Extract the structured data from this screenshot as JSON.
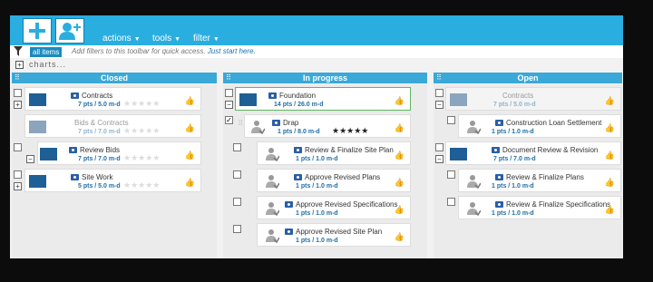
{
  "toolbar": {
    "menus": [
      {
        "label": "actions"
      },
      {
        "label": "tools"
      },
      {
        "label": "filter"
      }
    ]
  },
  "filterbar": {
    "chip": "all items",
    "hint": "Add filters to this toolbar for quick access.",
    "hint_link": "Just start here."
  },
  "charts_label": "charts...",
  "columns": [
    {
      "title": "Closed"
    },
    {
      "title": "In progress"
    },
    {
      "title": "Open"
    }
  ],
  "closed": [
    {
      "title": "Contracts",
      "meta": "7 pts / 5.0 m-d"
    },
    {
      "title": "Bids & Contracts",
      "meta": "7 pts / 7.0 m-d"
    },
    {
      "title": "Review Bids",
      "meta": "7 pts / 7.0 m-d"
    },
    {
      "title": "Site Work",
      "meta": "5 pts / 5.0 m-d"
    }
  ],
  "inprogress": [
    {
      "title": "Foundation",
      "meta": "14 pts / 26.0 m-d"
    },
    {
      "title": "Drap",
      "meta": "1 pts / 8.0 m-d"
    },
    {
      "title": "Review & Finalize Site Plan",
      "meta": "1 pts / 1.0 m-d"
    },
    {
      "title": "Approve Revised Plans",
      "meta": "1 pts / 1.0 m-d"
    },
    {
      "title": "Approve Revised Specifications",
      "meta": "1 pts / 1.0 m-d"
    },
    {
      "title": "Approve Revised Site Plan",
      "meta": "1 pts / 1.0 m-d"
    }
  ],
  "open": [
    {
      "title": "Contracts",
      "meta": "7 pts / 5.0 m-d"
    },
    {
      "title": "Construction Loan Settlement",
      "meta": "1 pts / 1.0 m-d"
    },
    {
      "title": "Document Review & Revision",
      "meta": "7 pts / 7.0 m-d"
    },
    {
      "title": "Review & Finalize Plans",
      "meta": "1 pts / 1.0 m-d"
    },
    {
      "title": "Review & Finalize Specifications",
      "meta": "1 pts / 1.0 m-d"
    }
  ],
  "drap_rating": 5,
  "colors": {
    "topbar": "#2aaee0",
    "header": "#3aa9d8",
    "selected_border": "#5cb85c",
    "meta_text": "#1e6fa8"
  },
  "icons": {
    "add": "plus-icon",
    "add_user": "add-user-icon",
    "filter": "funnel-icon",
    "folder": "folder-icon",
    "task": "person-task-icon",
    "like": "thumbs-up-icon"
  }
}
